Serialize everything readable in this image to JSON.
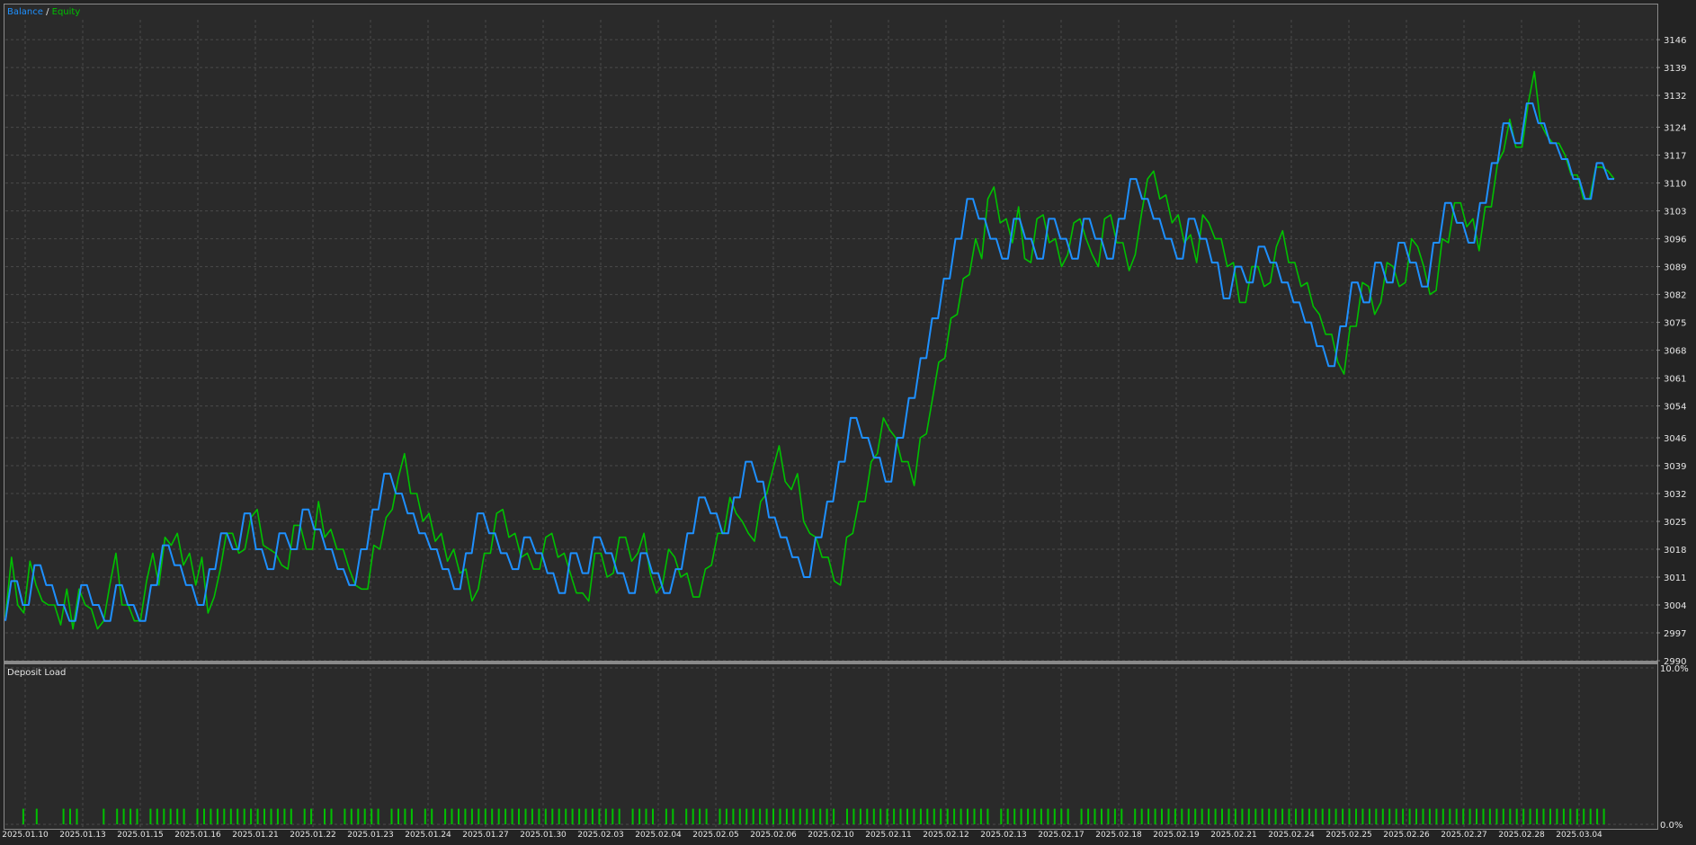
{
  "legend": {
    "balance_label": "Balance",
    "separator": " / ",
    "equity_label": "Equity"
  },
  "colors": {
    "background": "#2a2a2a",
    "outer": "#232323",
    "grid": "#4a4a4a",
    "border": "#8a8a8a",
    "text": "#e6e6e6",
    "balance": "#1e90ff",
    "equity": "#00c000"
  },
  "chart_data": [
    {
      "type": "line",
      "title": "",
      "legend_position": "top-left",
      "grid": true,
      "y_ticks": [
        2990,
        2997,
        3004,
        3011,
        3018,
        3025,
        3032,
        3039,
        3046,
        3054,
        3061,
        3068,
        3075,
        3082,
        3089,
        3096,
        3103,
        3110,
        3117,
        3124,
        3132,
        3139,
        3146
      ],
      "ylim": [
        2990,
        3151
      ],
      "x_ticks": [
        "2025.01.10",
        "2025.01.13",
        "2025.01.15",
        "2025.01.16",
        "2025.01.21",
        "2025.01.22",
        "2025.01.23",
        "2025.01.24",
        "2025.01.27",
        "2025.01.30",
        "2025.02.03",
        "2025.02.04",
        "2025.02.05",
        "2025.02.06",
        "2025.02.10",
        "2025.02.11",
        "2025.02.12",
        "2025.02.13",
        "2025.02.17",
        "2025.02.18",
        "2025.02.19",
        "2025.02.21",
        "2025.02.24",
        "2025.02.25",
        "2025.02.26",
        "2025.02.27",
        "2025.02.28",
        "2025.03.04"
      ],
      "series": [
        {
          "name": "Balance",
          "color": "#1e90ff",
          "values": [
            3000,
            3010,
            3010,
            3004,
            3004,
            3014,
            3014,
            3009,
            3009,
            3004,
            3004,
            3000,
            3000,
            3009,
            3009,
            3004,
            3004,
            3000,
            3000,
            3009,
            3009,
            3004,
            3004,
            3000,
            3000,
            3009,
            3009,
            3019,
            3019,
            3014,
            3014,
            3009,
            3009,
            3004,
            3004,
            3013,
            3013,
            3022,
            3022,
            3018,
            3018,
            3027,
            3027,
            3018,
            3018,
            3013,
            3013,
            3022,
            3022,
            3018,
            3018,
            3028,
            3028,
            3023,
            3023,
            3018,
            3018,
            3013,
            3013,
            3009,
            3009,
            3018,
            3018,
            3028,
            3028,
            3037,
            3037,
            3032,
            3032,
            3027,
            3027,
            3022,
            3022,
            3018,
            3018,
            3013,
            3013,
            3008,
            3008,
            3017,
            3017,
            3027,
            3027,
            3022,
            3022,
            3017,
            3017,
            3013,
            3013,
            3021,
            3021,
            3017,
            3017,
            3012,
            3012,
            3007,
            3007,
            3017,
            3017,
            3012,
            3012,
            3021,
            3021,
            3017,
            3017,
            3012,
            3012,
            3007,
            3007,
            3017,
            3017,
            3012,
            3012,
            3007,
            3007,
            3013,
            3013,
            3022,
            3022,
            3031,
            3031,
            3027,
            3027,
            3022,
            3022,
            3031,
            3031,
            3040,
            3040,
            3035,
            3035,
            3026,
            3026,
            3021,
            3021,
            3016,
            3016,
            3011,
            3011,
            3021,
            3021,
            3030,
            3030,
            3040,
            3040,
            3051,
            3051,
            3046,
            3046,
            3041,
            3041,
            3035,
            3035,
            3046,
            3046,
            3056,
            3056,
            3066,
            3066,
            3076,
            3076,
            3086,
            3086,
            3096,
            3096,
            3106,
            3106,
            3101,
            3101,
            3096,
            3096,
            3091,
            3091,
            3101,
            3101,
            3096,
            3096,
            3091,
            3091,
            3101,
            3101,
            3096,
            3096,
            3091,
            3091,
            3101,
            3101,
            3096,
            3096,
            3091,
            3091,
            3101,
            3101,
            3111,
            3111,
            3106,
            3106,
            3101,
            3101,
            3096,
            3096,
            3091,
            3091,
            3101,
            3101,
            3096,
            3096,
            3090,
            3090,
            3081,
            3081,
            3089,
            3089,
            3085,
            3085,
            3094,
            3094,
            3090,
            3090,
            3085,
            3085,
            3080,
            3080,
            3075,
            3075,
            3069,
            3069,
            3064,
            3064,
            3074,
            3074,
            3085,
            3085,
            3080,
            3080,
            3090,
            3090,
            3085,
            3085,
            3095,
            3095,
            3090,
            3090,
            3084,
            3084,
            3095,
            3095,
            3105,
            3105,
            3100,
            3100,
            3095,
            3095,
            3105,
            3105,
            3115,
            3115,
            3125,
            3125,
            3120,
            3120,
            3130,
            3130,
            3125,
            3125,
            3120,
            3120,
            3116,
            3116,
            3111,
            3111,
            3106,
            3106,
            3115,
            3115,
            3111,
            3111
          ]
        },
        {
          "name": "Equity",
          "color": "#00c000",
          "values": [
            3001,
            3016,
            3004,
            3002,
            3015,
            3009,
            3005,
            3004,
            3004,
            2999,
            3008,
            2998,
            3008,
            3004,
            3003,
            2998,
            3000,
            3009,
            3017,
            3004,
            3004,
            3000,
            3000,
            3010,
            3017,
            3009,
            3021,
            3019,
            3022,
            3014,
            3017,
            3009,
            3016,
            3002,
            3006,
            3013,
            3022,
            3022,
            3017,
            3018,
            3026,
            3028,
            3019,
            3018,
            3017,
            3014,
            3013,
            3024,
            3024,
            3018,
            3018,
            3030,
            3021,
            3023,
            3018,
            3018,
            3013,
            3009,
            3008,
            3008,
            3019,
            3018,
            3026,
            3028,
            3036,
            3042,
            3032,
            3032,
            3025,
            3027,
            3020,
            3022,
            3015,
            3018,
            3012,
            3013,
            3005,
            3008,
            3017,
            3017,
            3027,
            3028,
            3021,
            3022,
            3016,
            3017,
            3013,
            3013,
            3021,
            3022,
            3016,
            3017,
            3012,
            3007,
            3007,
            3005,
            3017,
            3017,
            3011,
            3012,
            3021,
            3021,
            3015,
            3017,
            3022,
            3012,
            3007,
            3009,
            3018,
            3016,
            3011,
            3012,
            3006,
            3006,
            3013,
            3014,
            3022,
            3022,
            3031,
            3027,
            3025,
            3022,
            3020,
            3030,
            3032,
            3038,
            3044,
            3035,
            3033,
            3037,
            3025,
            3022,
            3021,
            3016,
            3016,
            3010,
            3009,
            3021,
            3022,
            3030,
            3030,
            3040,
            3042,
            3051,
            3048,
            3046,
            3040,
            3040,
            3034,
            3046,
            3047,
            3056,
            3065,
            3066,
            3076,
            3077,
            3086,
            3087,
            3096,
            3091,
            3106,
            3109,
            3100,
            3101,
            3095,
            3104,
            3091,
            3090,
            3101,
            3102,
            3095,
            3096,
            3089,
            3092,
            3100,
            3101,
            3096,
            3092,
            3089,
            3101,
            3102,
            3095,
            3095,
            3088,
            3092,
            3102,
            3111,
            3113,
            3106,
            3107,
            3100,
            3102,
            3095,
            3097,
            3090,
            3102,
            3100,
            3096,
            3096,
            3089,
            3090,
            3080,
            3080,
            3089,
            3089,
            3084,
            3085,
            3094,
            3098,
            3090,
            3090,
            3084,
            3085,
            3079,
            3077,
            3072,
            3072,
            3065,
            3062,
            3074,
            3074,
            3085,
            3084,
            3077,
            3080,
            3090,
            3089,
            3084,
            3085,
            3096,
            3094,
            3089,
            3082,
            3083,
            3096,
            3095,
            3105,
            3105,
            3099,
            3101,
            3093,
            3104,
            3104,
            3115,
            3118,
            3126,
            3119,
            3119,
            3130,
            3138,
            3125,
            3122,
            3120,
            3120,
            3117,
            3112,
            3112,
            3106,
            3106,
            3114,
            3114,
            3113,
            3111
          ]
        }
      ]
    },
    {
      "type": "bar",
      "title": "Deposit Load",
      "y_ticks": [
        "10.0%",
        "0.0%"
      ],
      "ylim": [
        0,
        10
      ],
      "value_unit": "%",
      "bar_count": 240,
      "bar_value": 1.0,
      "bar_indices": [
        2,
        4,
        8,
        9,
        10,
        14,
        16,
        17,
        18,
        19,
        21,
        22,
        23,
        24,
        25,
        26,
        28,
        29,
        30,
        31,
        32,
        33,
        34,
        35,
        36,
        37,
        38,
        39,
        40,
        41,
        42,
        44,
        45,
        47,
        48,
        50,
        51,
        52,
        53,
        54,
        55,
        57,
        58,
        59,
        60,
        62,
        63,
        65,
        66,
        67,
        68,
        69,
        70,
        71,
        72,
        73,
        74,
        75,
        76,
        77,
        78,
        79,
        80,
        81,
        82,
        83,
        84,
        85,
        86,
        87,
        88,
        89,
        90,
        91,
        93,
        94,
        95,
        96,
        98,
        99,
        101,
        102,
        103,
        104,
        106,
        107,
        108,
        109,
        110,
        111,
        112,
        113,
        114,
        115,
        116,
        117,
        118,
        119,
        120,
        121,
        122,
        123,
        125,
        126,
        127,
        128,
        129,
        130,
        131,
        132,
        133,
        134,
        135,
        136,
        137,
        138,
        139,
        140,
        141,
        142,
        143,
        144,
        145,
        146,
        148,
        149,
        150,
        151,
        152,
        153,
        154,
        155,
        156,
        157,
        158,
        160,
        161,
        162,
        163,
        164,
        165,
        166,
        168,
        169,
        170,
        171,
        172,
        173,
        174,
        175,
        176,
        177,
        178,
        179,
        180,
        181,
        182,
        183,
        184,
        185,
        186,
        187,
        188,
        189,
        190,
        191,
        192,
        193,
        194,
        195,
        196,
        197,
        198,
        199,
        200,
        201,
        202,
        203,
        204,
        205,
        206,
        207,
        208,
        209,
        210,
        211,
        212,
        213,
        214,
        215,
        216,
        217,
        218,
        219,
        220,
        221,
        222,
        223,
        224,
        225,
        226,
        227,
        228,
        229,
        230,
        231,
        232,
        233,
        234,
        235,
        236,
        237,
        238
      ]
    }
  ]
}
